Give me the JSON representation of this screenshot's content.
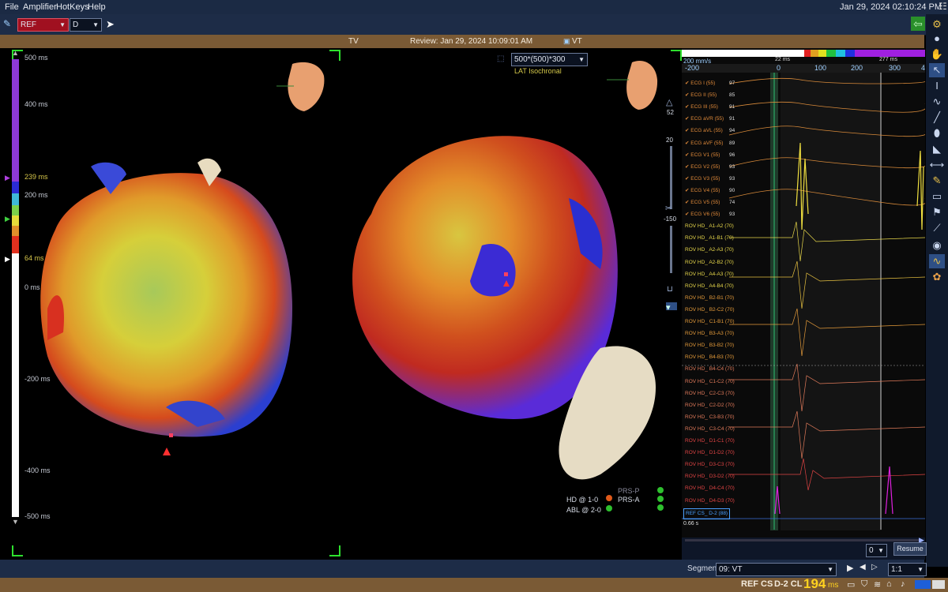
{
  "menu": [
    "File",
    "Amplifier",
    "HotKeys",
    "Help"
  ],
  "clock": "Jan 29, 2024 02:10:24 PM",
  "toolbar": {
    "ref_select": "REF",
    "d_select": "D"
  },
  "infobar": {
    "left": "TV",
    "review": "Review: Jan 29, 2024 10:09:01 AM",
    "map": "VT"
  },
  "scale": {
    "ticks": [
      "500 ms",
      "400 ms",
      "239 ms",
      "200 ms",
      "64 ms",
      "0 ms",
      "-200 ms",
      "-400 ms",
      "-500 ms"
    ]
  },
  "map_select": "500*(500)*300",
  "map_type": "LAT Isochronal",
  "side": {
    "v52": "52",
    "v20": "20",
    "vneg150": "-150"
  },
  "legend": {
    "hd": "HD @ 1-0",
    "abl": "ABL @ 2-0",
    "prsp": "PRS-P",
    "prsa": "PRS-A"
  },
  "ep": {
    "speed": "200 mm/s",
    "ruler": [
      "-200",
      "0",
      "100",
      "200",
      "300",
      "4"
    ],
    "mark1": "22 ms",
    "mark2": "277 ms",
    "channels": [
      {
        "name": "ECG I (55)",
        "v": "97",
        "c": "#e08a3a"
      },
      {
        "name": "ECG II (55)",
        "v": "85",
        "c": "#e08a3a"
      },
      {
        "name": "ECG III (55)",
        "v": "91",
        "c": "#e08a3a"
      },
      {
        "name": "ECG aVR (55)",
        "v": "91",
        "c": "#e08a3a"
      },
      {
        "name": "ECG aVL (55)",
        "v": "94",
        "c": "#e08a3a"
      },
      {
        "name": "ECG aVF (55)",
        "v": "89",
        "c": "#e08a3a"
      },
      {
        "name": "ECG V1 (55)",
        "v": "96",
        "c": "#e08a3a"
      },
      {
        "name": "ECG V2 (55)",
        "v": "93",
        "c": "#e08a3a"
      },
      {
        "name": "ECG V3 (55)",
        "v": "93",
        "c": "#e08a3a"
      },
      {
        "name": "ECG V4 (55)",
        "v": "90",
        "c": "#e08a3a"
      },
      {
        "name": "ECG V5 (55)",
        "v": "74",
        "c": "#e08a3a"
      },
      {
        "name": "ECG V6 (55)",
        "v": "93",
        "c": "#e08a3a"
      },
      {
        "name": "ROV HD_ A1-A2 (70)",
        "v": "",
        "c": "#e6d64a"
      },
      {
        "name": "ROV HD_ A1-B1 (70)",
        "v": "",
        "c": "#e6d64a"
      },
      {
        "name": "ROV HD_ A2-A3 (70)",
        "v": "",
        "c": "#e6d64a"
      },
      {
        "name": "ROV HD_ A2-B2 (70)",
        "v": "",
        "c": "#e6d64a"
      },
      {
        "name": "ROV HD_ A4-A3 (70)",
        "v": "",
        "c": "#e6d64a"
      },
      {
        "name": "ROV HD_ A4-B4 (70)",
        "v": "",
        "c": "#e6d64a"
      },
      {
        "name": "ROV HD_ B2-B1 (70)",
        "v": "",
        "c": "#e39a3a"
      },
      {
        "name": "ROV HD_ B2-C2 (70)",
        "v": "",
        "c": "#e39a3a"
      },
      {
        "name": "ROV HD_ C1-B1 (70)",
        "v": "",
        "c": "#e39a3a"
      },
      {
        "name": "ROV HD_ B3-A3 (70)",
        "v": "",
        "c": "#e39a3a"
      },
      {
        "name": "ROV HD_ B3-B2 (70)",
        "v": "",
        "c": "#e39a3a"
      },
      {
        "name": "ROV HD_ B4-B3 (70)",
        "v": "",
        "c": "#e39a3a"
      },
      {
        "name": "ROV HD_ B4-C4 (70)",
        "v": "",
        "c": "#e07a5a"
      },
      {
        "name": "ROV HD_ C1-C2 (70)",
        "v": "",
        "c": "#e07a5a"
      },
      {
        "name": "ROV HD_ C2-C3 (70)",
        "v": "",
        "c": "#e07a5a"
      },
      {
        "name": "ROV HD_ C2-D2 (70)",
        "v": "",
        "c": "#e07a5a"
      },
      {
        "name": "ROV HD_ C3-B3 (70)",
        "v": "",
        "c": "#e07a5a"
      },
      {
        "name": "ROV HD_ C3-C4 (70)",
        "v": "",
        "c": "#e07a5a"
      },
      {
        "name": "ROV HD_ D1-C1 (70)",
        "v": "",
        "c": "#e04444"
      },
      {
        "name": "ROV HD_ D1-D2 (70)",
        "v": "",
        "c": "#e04444"
      },
      {
        "name": "ROV HD_ D3-C3 (70)",
        "v": "",
        "c": "#e04444"
      },
      {
        "name": "ROV HD_ D3-D2 (70)",
        "v": "",
        "c": "#e04444"
      },
      {
        "name": "ROV HD_ D4-C4 (70)",
        "v": "",
        "c": "#e04444"
      },
      {
        "name": "ROV HD_ D4-D3 (70)",
        "v": "",
        "c": "#e04444"
      },
      {
        "name": "REF CS_ D-2 (88)",
        "v": "",
        "c": "#4aa0ff"
      }
    ],
    "scale_left": "0.66 s",
    "rate_select": "0",
    "resume": "Resume"
  },
  "segment": {
    "label": "Segment",
    "value": "09: VT",
    "ratio": "1:1"
  },
  "status": {
    "ref": "REF CS",
    "cl_label": "D-2 CL",
    "cl_value": "194",
    "unit": "ms"
  }
}
